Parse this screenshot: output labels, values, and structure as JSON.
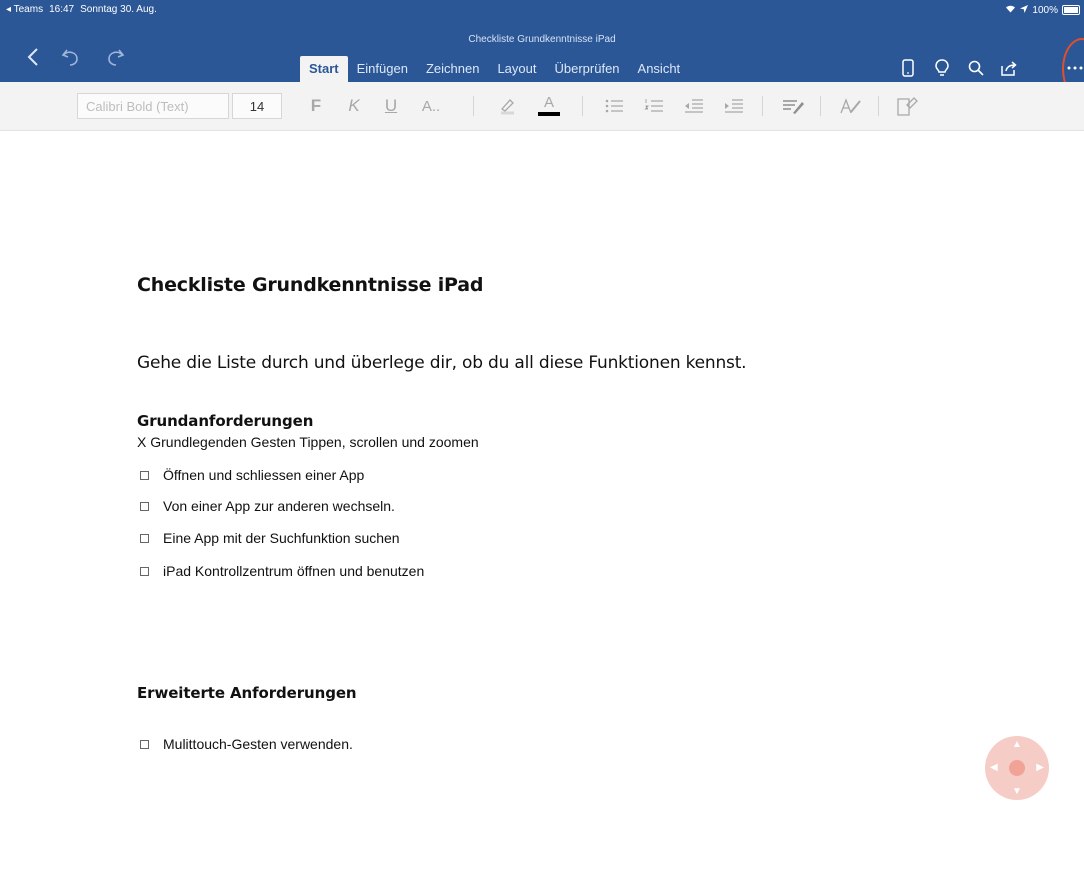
{
  "status_bar": {
    "back_app": "◂ Teams",
    "time": "16:47",
    "date": "Sonntag 30. Aug.",
    "battery": "100%"
  },
  "document_title": "Checkliste Grundkenntnisse iPad",
  "tabs": [
    {
      "label": "Start",
      "active": true
    },
    {
      "label": "Einfügen",
      "active": false
    },
    {
      "label": "Zeichnen",
      "active": false
    },
    {
      "label": "Layout",
      "active": false
    },
    {
      "label": "Überprüfen",
      "active": false
    },
    {
      "label": "Ansicht",
      "active": false
    }
  ],
  "toolbar": {
    "font_name": "Calibri Bold (Text)",
    "font_size": "14",
    "bold": "F",
    "italic": "K",
    "underline": "U",
    "font_options": "A..",
    "font_color": "A"
  },
  "colors": {
    "ribbon_blue": "#2b5797",
    "highlight_circle": "#e05028",
    "fab": "#f6c7c0"
  },
  "content": {
    "heading": "Checkliste Grundkenntnisse iPad",
    "intro": "Gehe die Liste durch und überlege dir, ob du all diese Funktionen kennst.",
    "section1": {
      "title": "Grundanforderungen",
      "line": "X Grundlegenden Gesten Tippen, scrollen und zoomen",
      "items": [
        "Öffnen und schliessen einer App",
        "Von einer App zur anderen wechseln.",
        "Eine App mit der Suchfunktion suchen",
        "iPad Kontrollzentrum öffnen und benutzen"
      ]
    },
    "section2": {
      "title": "Erweiterte Anforderungen",
      "items": [
        "Mulittouch-Gesten verwenden."
      ]
    }
  }
}
